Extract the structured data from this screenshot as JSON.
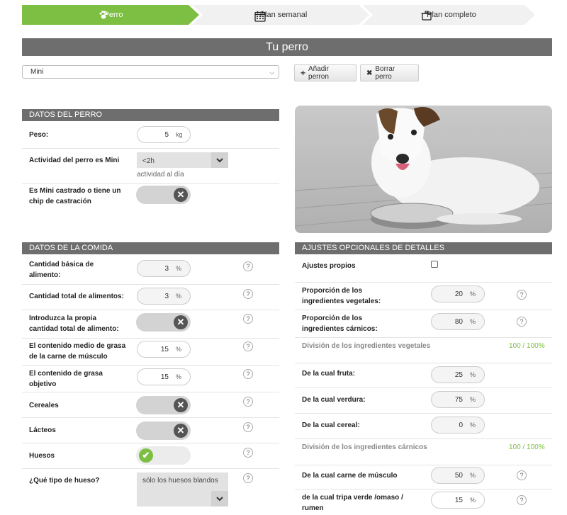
{
  "steps": [
    {
      "label": "Perro",
      "icon": "paw-icon",
      "active": true
    },
    {
      "label": "Plan semanal",
      "icon": "calendar-icon",
      "active": false
    },
    {
      "label": "Plan completo",
      "icon": "pot-icon",
      "active": false
    }
  ],
  "page_title": "Tu perro",
  "dog_select": {
    "value": "Mini"
  },
  "buttons": {
    "add": "Añadir perron",
    "delete": "Borrar perro"
  },
  "dog_section": {
    "title": "DATOS DEL PERRO",
    "weight_label": "Peso:",
    "weight_value": "5",
    "weight_unit": "kg",
    "activity_label": "Actividad del perro es Mini",
    "activity_value": "<2h",
    "activity_hint": "actividad al día",
    "castrated_label": "Es Mini castrado o tiene un chip de castración"
  },
  "food_section": {
    "title": "DATOS DE LA COMIDA",
    "rows": [
      {
        "label": "Cantidad básica de alimento:",
        "value": "3",
        "unit": "%"
      },
      {
        "label": "Cantidad total de alimentos:",
        "value": "3",
        "unit": "%"
      },
      {
        "label": "Introduzca la propia cantidad total de alimento:"
      },
      {
        "label": "El contenido medio de grasa de la carne de músculo",
        "value": "15",
        "unit": "%"
      },
      {
        "label": "El contenido de grasa objetivo",
        "value": "15",
        "unit": "%"
      },
      {
        "label": "Cereales"
      },
      {
        "label": "Lácteos"
      },
      {
        "label": "Huesos"
      },
      {
        "label": "¿Qué tipo de hueso?",
        "value": "sólo los huesos blandos"
      }
    ]
  },
  "options_section": {
    "title": "AJUSTES OPCIONALES DE DETALLES",
    "own_settings_label": "Ajustes propios",
    "veg_prop_label": "Proporción de los ingredientes vegetales:",
    "veg_prop_value": "20",
    "veg_prop_unit": "%",
    "meat_prop_label": "Proporción de los ingredientes cárnicos:",
    "meat_prop_value": "80",
    "meat_prop_unit": "%",
    "veg_split_label": "División de los ingredientes vegetales",
    "veg_split_ratio": "100 / 100%",
    "fruit_label": "De la cual fruta:",
    "fruit_value": "25",
    "fruit_unit": "%",
    "vegetable_label": "De la cual verdura:",
    "vegetable_value": "75",
    "vegetable_unit": "%",
    "cereal_label": "De la cual cereal:",
    "cereal_value": "0",
    "cereal_unit": "%",
    "meat_split_label": "División de los ingredientes cárnicos",
    "meat_split_ratio": "100 / 100%",
    "muscle_label": "De la cual carne de músculo",
    "muscle_value": "50",
    "muscle_unit": "%",
    "tripe_label": "de la cual tripa verde /omaso / rumen",
    "tripe_value": "15",
    "tripe_unit": "%"
  },
  "help_glyph": "?",
  "colors": {
    "accent": "#7cbf43",
    "header": "#6e6e6e"
  }
}
